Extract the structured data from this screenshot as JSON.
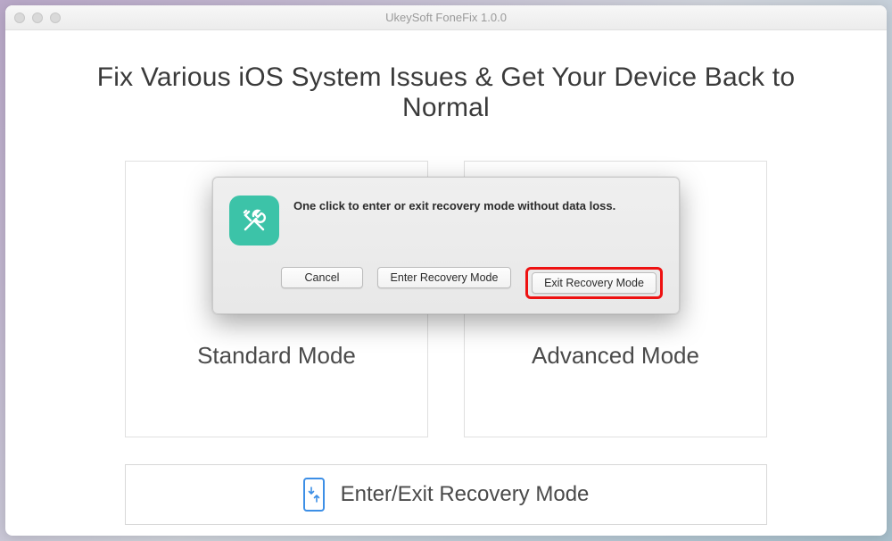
{
  "window": {
    "title": "UkeySoft FoneFix 1.0.0"
  },
  "main": {
    "heading": "Fix Various iOS System Issues & Get Your Device Back to Normal",
    "cards": [
      {
        "title": "Standard Mode"
      },
      {
        "title": "Advanced Mode"
      }
    ],
    "recovery_button_label": "Enter/Exit Recovery Mode"
  },
  "dialog": {
    "message": "One click to enter or exit recovery mode without data loss.",
    "cancel_label": "Cancel",
    "enter_label": "Enter Recovery Mode",
    "exit_label": "Exit Recovery Mode"
  },
  "icons": {
    "tools": "tools-icon",
    "phone_arrows": "phone-arrows-icon"
  }
}
